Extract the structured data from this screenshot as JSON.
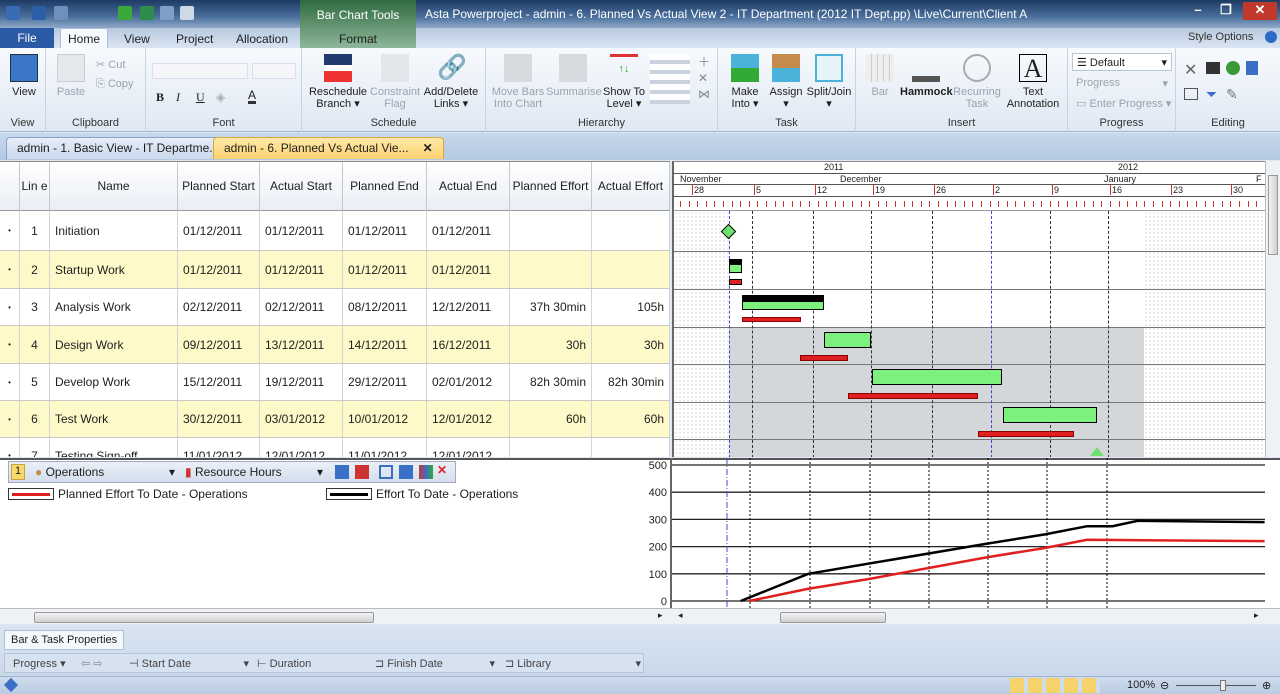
{
  "app": {
    "title": "Asta Powerproject - admin - 6. Planned Vs Actual View 2 - IT Department (2012 IT Dept.pp) \\Live\\Current\\Client A",
    "context_tool": "Bar Chart Tools",
    "context_tab": "Format"
  },
  "ribbon_tabs": [
    "File",
    "Home",
    "View",
    "Project",
    "Allocation"
  ],
  "style_options": "Style Options",
  "ribbon": {
    "view": {
      "label": "View",
      "group": "View"
    },
    "clipboard": {
      "paste": "Paste",
      "cut": "Cut",
      "copy": "Copy",
      "group": "Clipboard"
    },
    "font": {
      "group": "Font",
      "bold": "B",
      "italic": "I",
      "underline": "U",
      "color": "A"
    },
    "schedule": {
      "reschedule": "Reschedule Branch",
      "constraint": "Constraint Flag",
      "links": "Add/Delete Links",
      "group": "Schedule"
    },
    "hierarchy": {
      "move_bars": "Move Bars Into Chart",
      "summarise": "Summarise",
      "show_to_level": "Show To Level",
      "group": "Hierarchy"
    },
    "task": {
      "make_into": "Make Into",
      "assign": "Assign",
      "split_join": "Split/Join",
      "group": "Task"
    },
    "insert": {
      "bar": "Bar",
      "hammock": "Hammock",
      "recurring": "Recurring Task",
      "text_annotation": "Text Annotation",
      "group": "Insert"
    },
    "progress": {
      "default": "Default",
      "progress": "Progress",
      "enter_progress": "Enter Progress",
      "group": "Progress"
    },
    "editing": {
      "group": "Editing"
    }
  },
  "doc_tabs": [
    {
      "label": "admin - 1. Basic View - IT Departme...",
      "active": false
    },
    {
      "label": "admin - 6. Planned Vs Actual Vie...",
      "active": true
    }
  ],
  "table": {
    "columns": [
      "Lin e",
      "Name",
      "Planned Start",
      "Actual Start",
      "Planned End",
      "Actual End",
      "Planned Effort",
      "Actual Effort"
    ],
    "rows": [
      {
        "line": "1",
        "name": "Initiation",
        "ps": "01/12/2011",
        "as": "01/12/2011",
        "pe": "01/12/2011",
        "ae": "01/12/2011",
        "peff": "",
        "aeff": ""
      },
      {
        "line": "2",
        "name": "Startup Work",
        "ps": "01/12/2011",
        "as": "01/12/2011",
        "pe": "01/12/2011",
        "ae": "01/12/2011",
        "peff": "",
        "aeff": ""
      },
      {
        "line": "3",
        "name": "Analysis Work",
        "ps": "02/12/2011",
        "as": "02/12/2011",
        "pe": "08/12/2011",
        "ae": "12/12/2011",
        "peff": "37h 30min",
        "aeff": "105h"
      },
      {
        "line": "4",
        "name": "Design Work",
        "ps": "09/12/2011",
        "as": "13/12/2011",
        "pe": "14/12/2011",
        "ae": "16/12/2011",
        "peff": "30h",
        "aeff": "30h"
      },
      {
        "line": "5",
        "name": "Develop Work",
        "ps": "15/12/2011",
        "as": "19/12/2011",
        "pe": "29/12/2011",
        "ae": "02/01/2012",
        "peff": "82h 30min",
        "aeff": "82h 30min"
      },
      {
        "line": "6",
        "name": "Test Work",
        "ps": "30/12/2011",
        "as": "03/01/2012",
        "pe": "10/01/2012",
        "ae": "12/01/2012",
        "peff": "60h",
        "aeff": "60h"
      },
      {
        "line": "7",
        "name": "Testing Sign-off",
        "ps": "11/01/2012",
        "as": "12/01/2012",
        "pe": "11/01/2012",
        "ae": "12/01/2012",
        "peff": "",
        "aeff": ""
      }
    ]
  },
  "timescale": {
    "years": [
      "2011",
      "2012"
    ],
    "months": [
      "November",
      "December",
      "January",
      "F"
    ],
    "days": [
      "28",
      "5",
      "12",
      "19",
      "26",
      "2",
      "9",
      "16",
      "23",
      "30"
    ]
  },
  "histogram": {
    "page": "1",
    "resource": "Operations",
    "measure": "Resource Hours",
    "legend": [
      {
        "label": "Planned Effort To Date - Operations",
        "color": "#e02020"
      },
      {
        "label": "Effort To Date - Operations",
        "color": "#000000"
      }
    ],
    "y_ticks": [
      "500",
      "400",
      "300",
      "200",
      "100",
      "0"
    ]
  },
  "chart_data": {
    "type": "line",
    "ylim": [
      0,
      500
    ],
    "yticks": [
      0,
      100,
      200,
      300,
      400,
      500
    ],
    "grid": true,
    "series": [
      {
        "name": "Planned Effort To Date - Operations",
        "color": "#e02020",
        "points": [
          [
            "2011-12-05",
            0
          ],
          [
            "2011-12-12",
            45
          ],
          [
            "2011-12-19",
            80
          ],
          [
            "2011-12-26",
            120
          ],
          [
            "2012-01-02",
            160
          ],
          [
            "2012-01-09",
            195
          ],
          [
            "2012-01-14",
            225
          ],
          [
            "2012-02-04",
            220
          ]
        ]
      },
      {
        "name": "Effort To Date - Operations",
        "color": "#000000",
        "points": [
          [
            "2011-12-04",
            0
          ],
          [
            "2011-12-12",
            100
          ],
          [
            "2012-01-02",
            210
          ],
          [
            "2012-01-09",
            245
          ],
          [
            "2012-01-14",
            275
          ],
          [
            "2012-01-17",
            275
          ],
          [
            "2012-01-20",
            295
          ],
          [
            "2012-02-04",
            290
          ]
        ]
      }
    ]
  },
  "bottom": {
    "panel_tab": "Bar & Task Properties",
    "progress": "Progress",
    "start_date": "Start Date",
    "duration": "Duration",
    "finish_date": "Finish Date",
    "library": "Library"
  },
  "status": {
    "zoom": "100%"
  }
}
